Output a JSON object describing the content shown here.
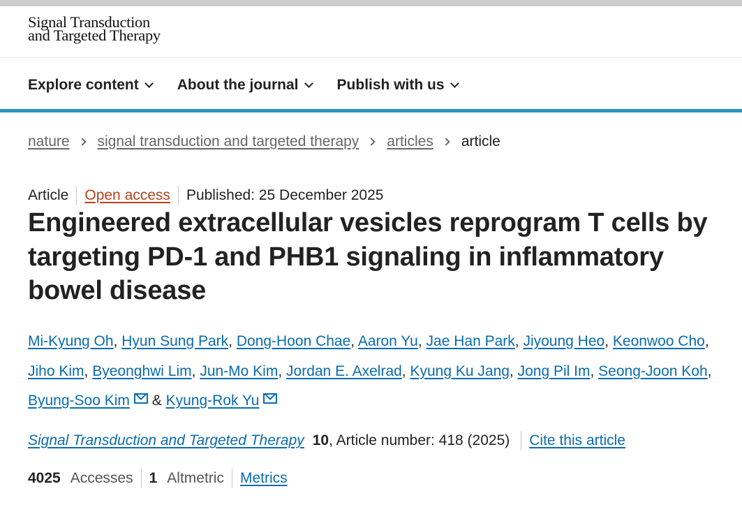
{
  "header": {
    "logo_line1": "Signal Transduction",
    "logo_line2": "and Targeted Therapy"
  },
  "nav": {
    "items": [
      {
        "label": "Explore content"
      },
      {
        "label": "About the journal"
      },
      {
        "label": "Publish with us"
      }
    ]
  },
  "breadcrumb": [
    "nature",
    "signal transduction and targeted therapy",
    "articles",
    "article"
  ],
  "article": {
    "type": "Article",
    "access": "Open access",
    "published": "Published: 25 December 2025",
    "title": "Engineered extracellular vesicles reprogram T cells by targeting PD-1 and PHB1 signaling in inflammatory bowel disease",
    "authors": [
      "Mi-Kyung Oh",
      "Hyun Sung Park",
      "Dong-Hoon Chae",
      "Aaron Yu",
      "Jae Han Park",
      "Jiyoung Heo",
      "Keonwoo Cho",
      "Jiho Kim",
      "Byeonghwi Lim",
      "Jun-Mo Kim",
      "Jordan E. Axelrad",
      "Kyung Ku Jang",
      "Jong Pil Im",
      "Seong-Joon Koh",
      "Byung-Soo Kim",
      "Kyung-Rok Yu"
    ],
    "author_sep": ",",
    "author_and": "&",
    "journal": "Signal Transduction and Targeted Therapy",
    "volume": "10",
    "article_number": ", Article number: 418 (2025)",
    "cite_label": "Cite this article"
  },
  "metrics": {
    "accesses_count": "4025",
    "accesses_label": "Accesses",
    "altmetric_count": "1",
    "altmetric_label": "Altmetric",
    "metrics_link": "Metrics"
  },
  "colors": {
    "accent_bar": "#2a95bd",
    "link": "#0a6cb0",
    "open_access": "#b7421b"
  }
}
